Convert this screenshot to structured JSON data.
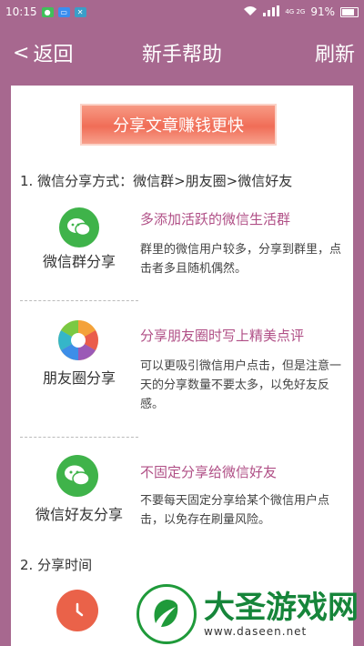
{
  "status": {
    "time": "10:15",
    "signal": "4G 2G",
    "battery": "91%"
  },
  "nav": {
    "back_label": "返回",
    "title": "新手帮助",
    "refresh_label": "刷新"
  },
  "banner": "分享文章赚钱更快",
  "section1": {
    "heading": "1. 微信分享方式：微信群>朋友圈>微信好友",
    "items": [
      {
        "icon": "wechat-group-icon",
        "label": "微信群分享",
        "title": "多添加活跃的微信生活群",
        "desc": "群里的微信用户较多，分享到群里，点击者多且随机偶然。"
      },
      {
        "icon": "moments-icon",
        "label": "朋友圈分享",
        "title": "分享朋友圈时写上精美点评",
        "desc": "可以更吸引微信用户点击，但是注意一天的分享数量不要太多，以免好友反感。"
      },
      {
        "icon": "wechat-friend-icon",
        "label": "微信好友分享",
        "title": "不固定分享给微信好友",
        "desc": "不要每天固定分享给某个微信用户点击，以免存在刷量风险。"
      }
    ]
  },
  "section2": {
    "heading": "2. 分享时间",
    "icon": "clock-icon"
  },
  "watermark": {
    "name": "大圣游戏网",
    "url": "www.daseen.net"
  },
  "colors": {
    "header": "#a7688f",
    "accent_text": "#b04f86",
    "banner": "#f06d57",
    "wechat_green": "#3fb34a"
  }
}
